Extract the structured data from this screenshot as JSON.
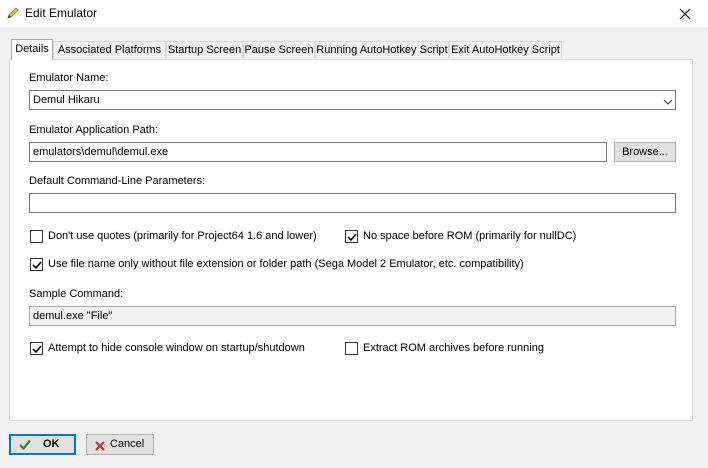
{
  "window": {
    "title": "Edit Emulator"
  },
  "tabs": [
    {
      "label": "Details",
      "active": true
    },
    {
      "label": "Associated Platforms"
    },
    {
      "label": "Startup Screen"
    },
    {
      "label": "Pause Screen"
    },
    {
      "label": "Running AutoHotkey Script"
    },
    {
      "label": "Exit AutoHotkey Script"
    }
  ],
  "form": {
    "emulator_name_label": "Emulator Name:",
    "emulator_name_value": "Demul Hikaru",
    "app_path_label": "Emulator Application Path:",
    "app_path_value": "emulators\\demul\\demul.exe",
    "browse_label": "Browse...",
    "cmd_params_label": "Default Command-Line Parameters:",
    "cmd_params_value": "",
    "sample_cmd_label": "Sample Command:",
    "sample_cmd_value": "demul.exe \"File\""
  },
  "checkboxes": {
    "no_quotes": {
      "label": "Don't use quotes (primarily for Project64 1.6 and lower)",
      "checked": false
    },
    "no_space": {
      "label": "No space before ROM (primarily for nullDC)",
      "checked": true
    },
    "file_name_only": {
      "label": "Use file name only without file extension or folder path (Sega Model 2 Emulator, etc. compatibility)",
      "checked": true
    },
    "hide_console": {
      "label": "Attempt to hide console window on startup/shutdown",
      "checked": true
    },
    "extract_rom": {
      "label": "Extract ROM archives before running",
      "checked": false
    }
  },
  "footer": {
    "ok_label": "OK",
    "cancel_label": "Cancel"
  },
  "colors": {
    "accent": "#0078d7",
    "ok_icon": "#2e8b2e",
    "cancel_icon": "#d9232d"
  }
}
